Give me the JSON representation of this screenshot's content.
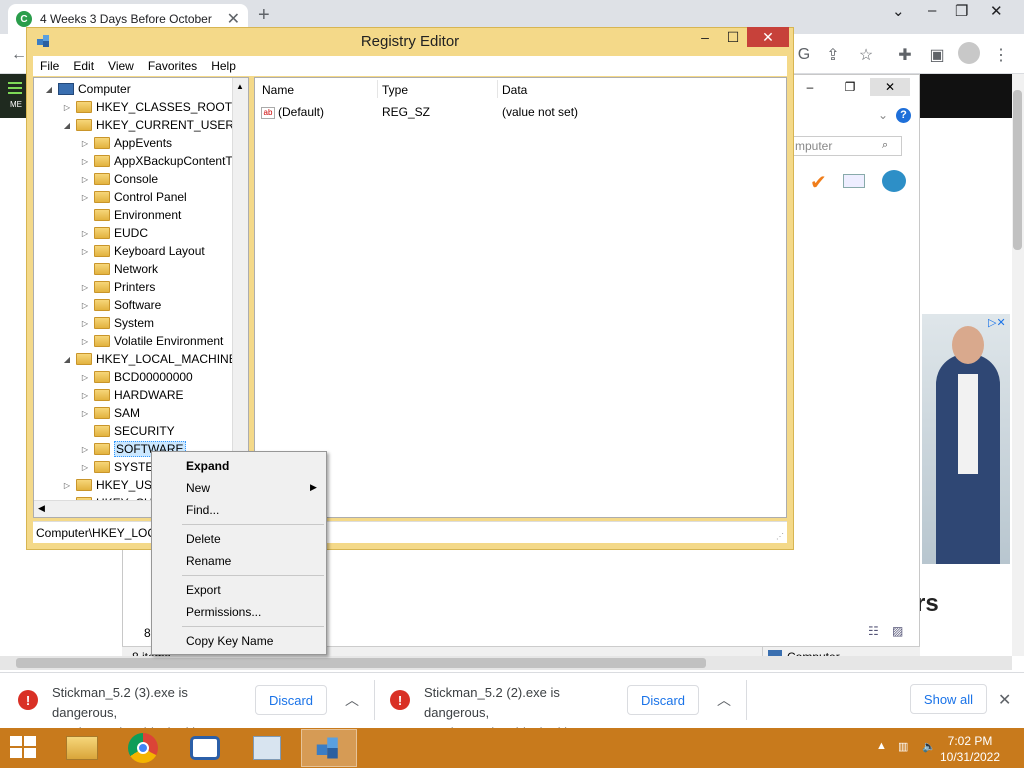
{
  "chrome": {
    "tab_title": "4 Weeks 3 Days Before October",
    "favicon_letter": "C",
    "new_tab": "+",
    "tab_close": "✕"
  },
  "background_window": {
    "search_placeholder": "mputer",
    "status_left": "8 items",
    "status_right": "Computer",
    "page_heading_fragment": "rs",
    "left_fragment": "8",
    "side_label": "ME"
  },
  "registry": {
    "title": "Registry Editor",
    "menu": [
      "File",
      "Edit",
      "View",
      "Favorites",
      "Help"
    ],
    "tree": [
      {
        "label": "Computer",
        "level": 0,
        "toggle": "◢",
        "icon": "computer"
      },
      {
        "label": "HKEY_CLASSES_ROOT",
        "level": 1,
        "toggle": "▷",
        "icon": "folder"
      },
      {
        "label": "HKEY_CURRENT_USER",
        "level": 1,
        "toggle": "◢",
        "icon": "folder"
      },
      {
        "label": "AppEvents",
        "level": 2,
        "toggle": "▷",
        "icon": "folder"
      },
      {
        "label": "AppXBackupContentT",
        "level": 2,
        "toggle": "▷",
        "icon": "folder"
      },
      {
        "label": "Console",
        "level": 2,
        "toggle": "▷",
        "icon": "folder"
      },
      {
        "label": "Control Panel",
        "level": 2,
        "toggle": "▷",
        "icon": "folder"
      },
      {
        "label": "Environment",
        "level": 2,
        "toggle": "",
        "icon": "folder"
      },
      {
        "label": "EUDC",
        "level": 2,
        "toggle": "▷",
        "icon": "folder"
      },
      {
        "label": "Keyboard Layout",
        "level": 2,
        "toggle": "▷",
        "icon": "folder"
      },
      {
        "label": "Network",
        "level": 2,
        "toggle": "",
        "icon": "folder"
      },
      {
        "label": "Printers",
        "level": 2,
        "toggle": "▷",
        "icon": "folder"
      },
      {
        "label": "Software",
        "level": 2,
        "toggle": "▷",
        "icon": "folder"
      },
      {
        "label": "System",
        "level": 2,
        "toggle": "▷",
        "icon": "folder"
      },
      {
        "label": "Volatile Environment",
        "level": 2,
        "toggle": "▷",
        "icon": "folder"
      },
      {
        "label": "HKEY_LOCAL_MACHINE",
        "level": 1,
        "toggle": "◢",
        "icon": "folder"
      },
      {
        "label": "BCD00000000",
        "level": 2,
        "toggle": "▷",
        "icon": "folder"
      },
      {
        "label": "HARDWARE",
        "level": 2,
        "toggle": "▷",
        "icon": "folder"
      },
      {
        "label": "SAM",
        "level": 2,
        "toggle": "▷",
        "icon": "folder"
      },
      {
        "label": "SECURITY",
        "level": 2,
        "toggle": "",
        "icon": "folder"
      },
      {
        "label": "SOFTWARE",
        "level": 2,
        "toggle": "▷",
        "icon": "folder",
        "selected": true
      },
      {
        "label": "SYSTEM",
        "level": 2,
        "toggle": "▷",
        "icon": "folder"
      },
      {
        "label": "HKEY_USERS",
        "level": 1,
        "toggle": "▷",
        "icon": "folder"
      },
      {
        "label": "HKEY_CURRENT_CONFIG",
        "level": 1,
        "toggle": "▷",
        "icon": "folder"
      }
    ],
    "columns": [
      "Name",
      "Type",
      "Data"
    ],
    "values": [
      {
        "name": "(Default)",
        "type": "REG_SZ",
        "data": "(value not set)"
      }
    ],
    "status_path": "Computer\\HKEY_LOCAL_MACHINE\\SOFTWARE"
  },
  "context_menu": {
    "expand": "Expand",
    "new": "New",
    "find": "Find...",
    "delete": "Delete",
    "rename": "Rename",
    "export": "Export",
    "permissions": "Permissions...",
    "copy_key_name": "Copy Key Name"
  },
  "downloads": [
    {
      "line1": "Stickman_5.2 (3).exe is dangerous,",
      "line2": "so Chrome has blocked it.",
      "button": "Discard"
    },
    {
      "line1": "Stickman_5.2 (2).exe is dangerous,",
      "line2": "so Chrome has blocked it.",
      "button": "Discard"
    }
  ],
  "show_all": "Show all",
  "taskbar": {
    "time": "7:02 PM",
    "date": "10/31/2022"
  },
  "colors": {
    "taskbar": "#c87a1c",
    "registry_frame": "#f4d989",
    "close_red": "#c7413a",
    "danger": "#d93025",
    "link_blue": "#1a73e8"
  }
}
